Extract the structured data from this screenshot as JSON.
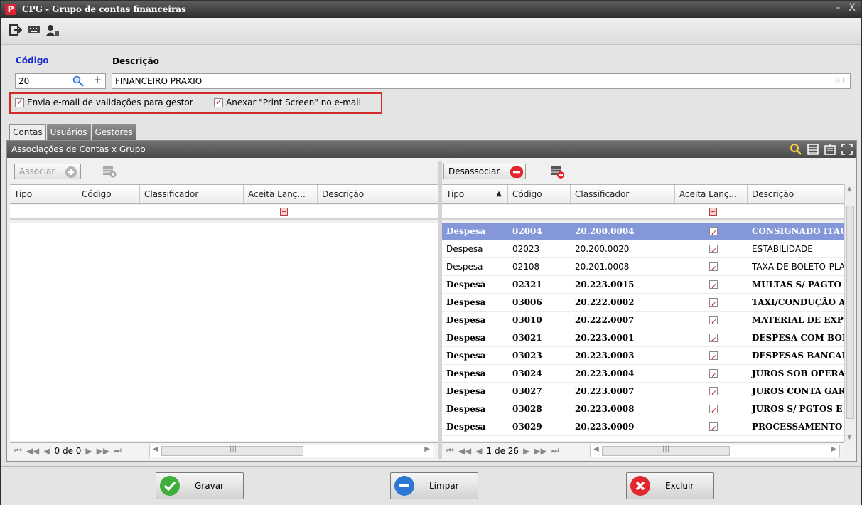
{
  "window": {
    "title": "CPG - Grupo de contas financeiras",
    "app_logo": "P",
    "minimize": "–",
    "close": "X"
  },
  "form": {
    "codigo_label": "Código",
    "descricao_label": "Descrição",
    "codigo_value": "20",
    "codigo_plus": "+",
    "descricao_value": "FINANCEIRO PRAXIO",
    "descricao_count": "83",
    "checkbox_envia": "Envia e-mail de validações para gestor",
    "checkbox_anexar": "Anexar \"Print Screen\" no e-mail"
  },
  "tabs": [
    "Contas",
    "Usuários",
    "Gestores"
  ],
  "panel": {
    "title": "Associações de Contas x Grupo"
  },
  "left": {
    "associar_label": "Associar",
    "columns": [
      "Tipo",
      "Código",
      "Classificador",
      "Aceita Lanç...",
      "Descrição"
    ],
    "pageinfo": "0 de 0",
    "nav_first": "⏮",
    "nav_prev2": "◀◀",
    "nav_prev": "◀",
    "nav_next": "▶",
    "nav_next2": "▶▶",
    "nav_last": "⏭",
    "scroll_left": "◀",
    "scroll_grip": "|||",
    "scroll_right": "▶"
  },
  "right": {
    "desassociar_label": "Desassociar",
    "columns": [
      "Tipo",
      "Código",
      "Classificador",
      "Aceita Lanç...",
      "Descrição"
    ],
    "sort_indicator": "▲",
    "pageinfo": "1 de 26",
    "rows": [
      {
        "tipo": "Despesa",
        "codigo": "02004",
        "classificador": "20.200.0004",
        "descricao": "CONSIGNADO ITAU",
        "style": "selected"
      },
      {
        "tipo": "Despesa",
        "codigo": "02023",
        "classificador": "20.200.0020",
        "descricao": "ESTABILIDADE",
        "style": "normal"
      },
      {
        "tipo": "Despesa",
        "codigo": "02108",
        "classificador": "20.201.0008",
        "descricao": "TAXA DE BOLETO-PLA",
        "style": "normal"
      },
      {
        "tipo": "Despesa",
        "codigo": "02321",
        "classificador": "20.223.0015",
        "descricao": "MULTAS S/ PAGTO",
        "style": "bold"
      },
      {
        "tipo": "Despesa",
        "codigo": "03006",
        "classificador": "20.222.0002",
        "descricao": "TAXI/CONDUÇÃO A",
        "style": "bold"
      },
      {
        "tipo": "Despesa",
        "codigo": "03010",
        "classificador": "20.222.0007",
        "descricao": "MATERIAL DE EXPE",
        "style": "bold"
      },
      {
        "tipo": "Despesa",
        "codigo": "03021",
        "classificador": "20.223.0001",
        "descricao": "DESPESA COM BOLE",
        "style": "bold"
      },
      {
        "tipo": "Despesa",
        "codigo": "03023",
        "classificador": "20.223.0003",
        "descricao": "DESPESAS BANCAR",
        "style": "bold"
      },
      {
        "tipo": "Despesa",
        "codigo": "03024",
        "classificador": "20.223.0004",
        "descricao": "JUROS SOB OPERA",
        "style": "bold"
      },
      {
        "tipo": "Despesa",
        "codigo": "03027",
        "classificador": "20.223.0007",
        "descricao": "JUROS CONTA GAR",
        "style": "bold"
      },
      {
        "tipo": "Despesa",
        "codigo": "03028",
        "classificador": "20.223.0008",
        "descricao": "JUROS S/ PGTOS E",
        "style": "bold"
      },
      {
        "tipo": "Despesa",
        "codigo": "03029",
        "classificador": "20.223.0009",
        "descricao": "PROCESSAMENTO D",
        "style": "bold"
      }
    ]
  },
  "buttons": {
    "gravar": "Gravar",
    "limpar": "Limpar",
    "excluir": "Excluir"
  },
  "colors": {
    "selected_row": "#8497d8",
    "accent_label": "#1b2ccf",
    "check_red": "#c62222",
    "highlight_frame": "#d42a2a"
  },
  "icons": [
    "exit-icon",
    "keyboard-icon",
    "user-icon",
    "search-icon",
    "plus-icon",
    "grid-view-icon",
    "export-icon",
    "fullscreen-icon",
    "associate-icon",
    "dissociate-icon",
    "gravar-check-icon",
    "limpar-minus-icon",
    "excluir-x-icon"
  ]
}
